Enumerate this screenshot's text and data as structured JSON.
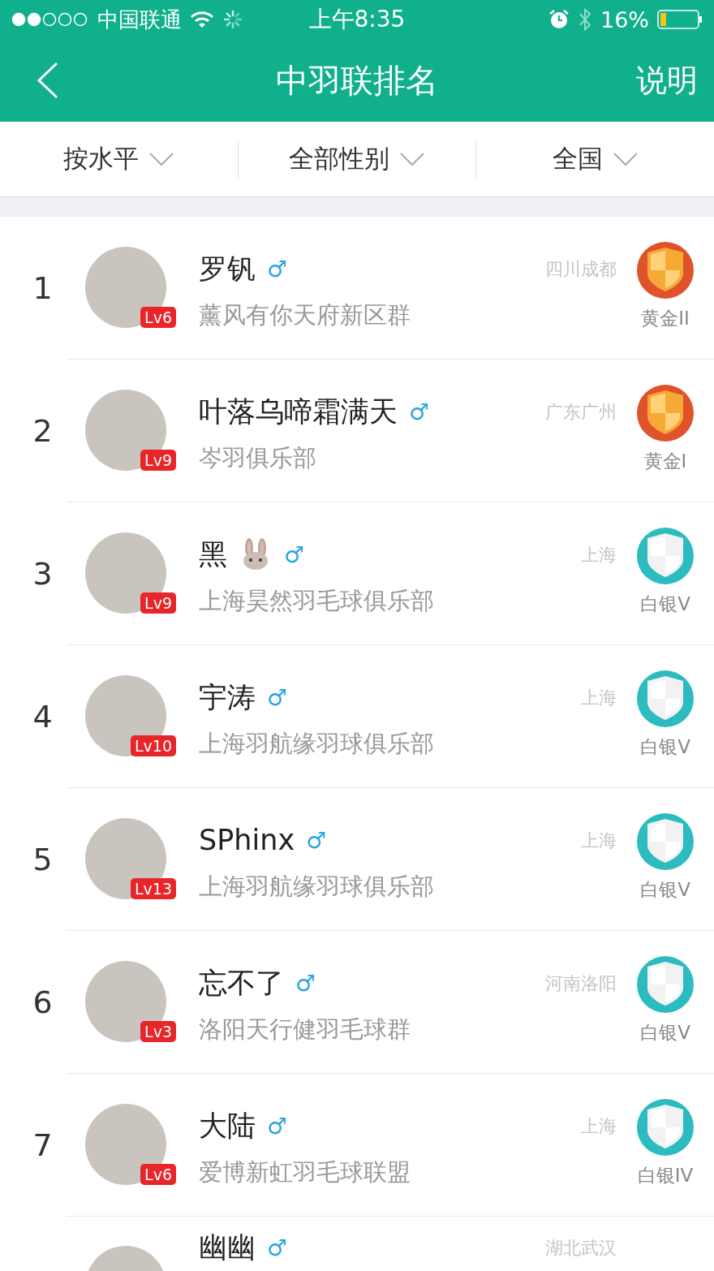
{
  "status_bar": {
    "carrier": "中国联通",
    "time": "上午8:35",
    "battery": "16%"
  },
  "nav": {
    "title": "中羽联排名",
    "action": "说明"
  },
  "filters": [
    {
      "label": "按水平"
    },
    {
      "label": "全部性别"
    },
    {
      "label": "全国"
    }
  ],
  "rankings": [
    {
      "rank": "1",
      "name": "罗钒",
      "gender": "♂",
      "level": "Lv6",
      "club": "薰风有你天府新区群",
      "location": "四川成都",
      "kind": "gold",
      "tier": "黄金II"
    },
    {
      "rank": "2",
      "name": "叶落乌啼霜满天",
      "gender": "♂",
      "level": "Lv9",
      "club": "岑羽俱乐部",
      "location": "广东广州",
      "kind": "gold",
      "tier": "黄金I"
    },
    {
      "rank": "3",
      "name": "黑",
      "has_icon": true,
      "gender": "♂",
      "level": "Lv9",
      "club": "上海昊然羽毛球俱乐部",
      "location": "上海",
      "kind": "silver",
      "tier": "白银V"
    },
    {
      "rank": "4",
      "name": "宇涛",
      "gender": "♂",
      "level": "Lv10",
      "club": "上海羽航缘羽球俱乐部",
      "location": "上海",
      "kind": "silver",
      "tier": "白银V"
    },
    {
      "rank": "5",
      "name": "SPhinx",
      "gender": "♂",
      "level": "Lv13",
      "club": "上海羽航缘羽球俱乐部",
      "location": "上海",
      "kind": "silver",
      "tier": "白银V"
    },
    {
      "rank": "6",
      "name": "忘不了",
      "gender": "♂",
      "level": "Lv3",
      "club": "洛阳天行健羽毛球群",
      "location": "河南洛阳",
      "kind": "silver",
      "tier": "白银V"
    },
    {
      "rank": "7",
      "name": "大陆",
      "gender": "♂",
      "level": "Lv6",
      "club": "爱博新虹羽毛球联盟",
      "location": "上海",
      "kind": "silver",
      "tier": "白银IV"
    },
    {
      "name": "幽幽",
      "gender": "♂",
      "location": "湖北武汉"
    }
  ]
}
